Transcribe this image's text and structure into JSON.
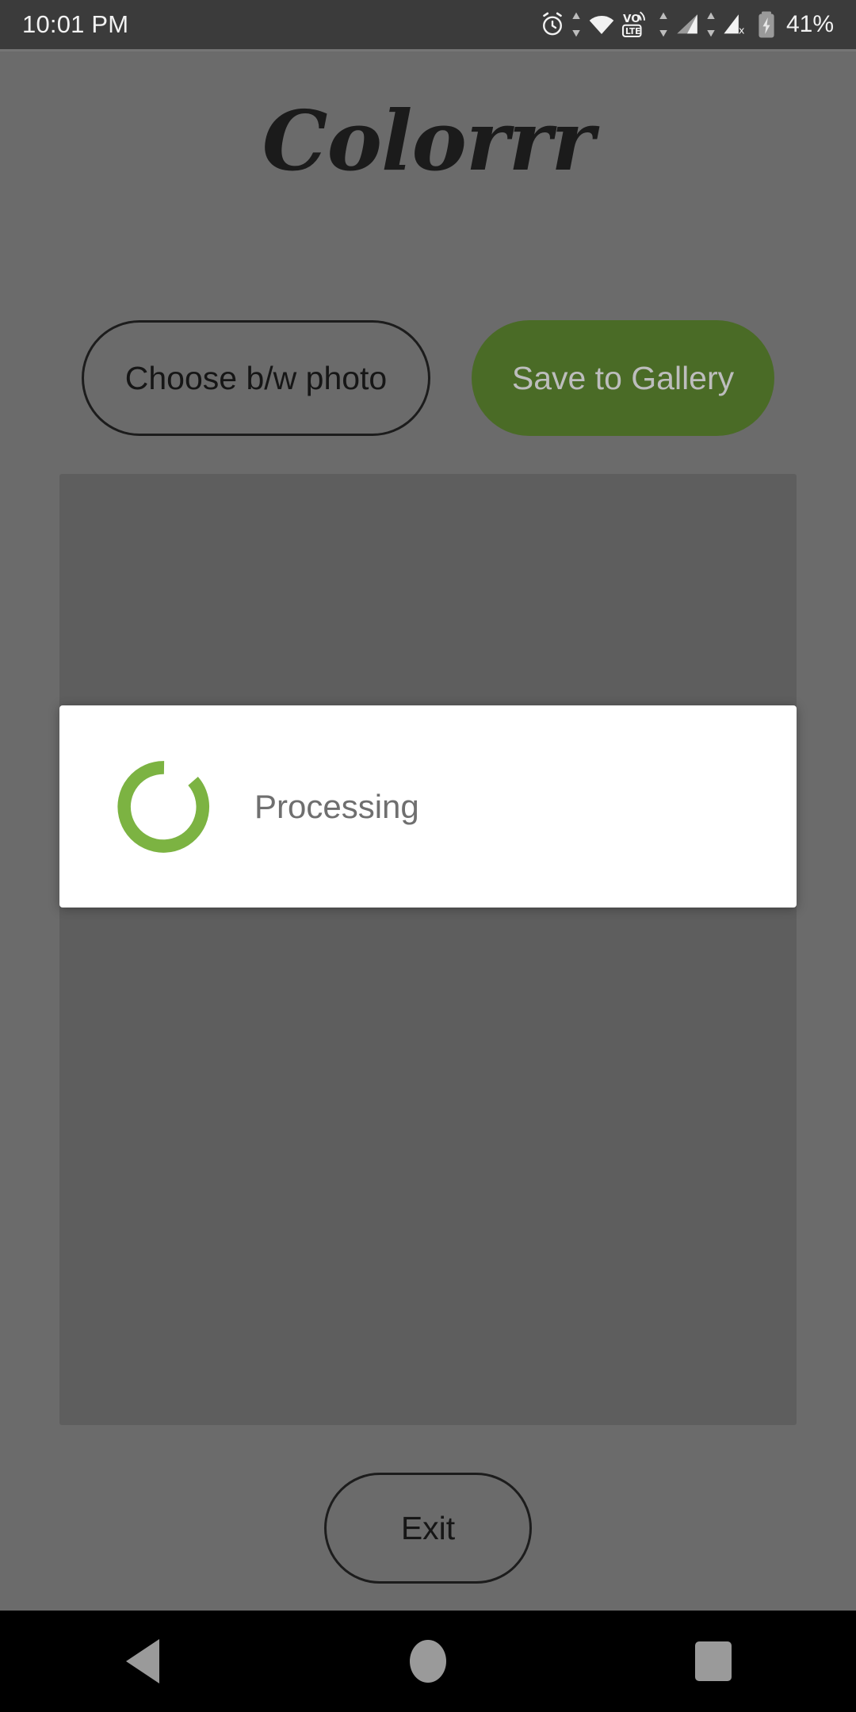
{
  "status_bar": {
    "time": "10:01 PM",
    "battery_percent": "41%",
    "icons": [
      "alarm-icon",
      "data-transfer-icon",
      "wifi-icon",
      "volte-icon",
      "data-transfer-icon-2",
      "signal-icon",
      "signal-no-service-icon",
      "battery-charging-icon"
    ]
  },
  "app": {
    "title": "Colorrr",
    "buttons": {
      "choose_photo": "Choose b/w photo",
      "save_gallery": "Save to Gallery",
      "exit": "Exit"
    }
  },
  "dialog": {
    "message": "Processing",
    "spinner": "loading-spinner-icon"
  },
  "nav_bar": {
    "back": "back-nav-button",
    "home": "home-nav-button",
    "recents": "recents-nav-button"
  },
  "colors": {
    "accent_green": "#4a6b26",
    "spinner_green": "#7cb342",
    "scrim_background": "#6b6b6b",
    "status_bar": "#3b3b3b",
    "dialog_background": "#ffffff",
    "nav_bar": "#000000"
  }
}
